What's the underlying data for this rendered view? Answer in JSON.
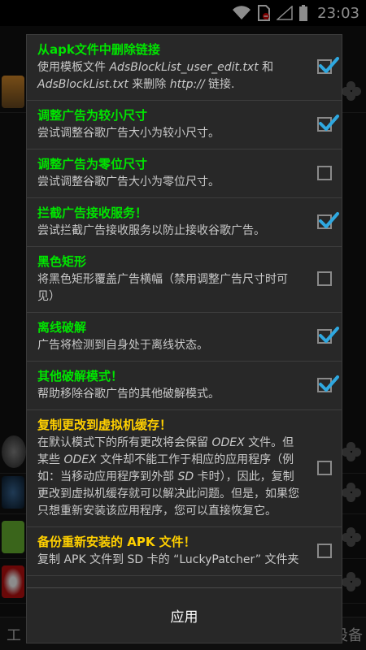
{
  "status_bar": {
    "time": "23:03"
  },
  "background": {
    "bottom_left": "工",
    "bottom_right": "载设备"
  },
  "dialog": {
    "items": [
      {
        "title": "从apk文件中删除链接",
        "title_color": "green",
        "desc": [
          "使用模板文件 ",
          {
            "i": "AdsBlockList_user_edit.txt"
          },
          " 和 ",
          {
            "i": "AdsBlockList.txt"
          },
          " 来删除 ",
          {
            "i": "http://"
          },
          " 链接."
        ],
        "checked": true
      },
      {
        "title": "调整广告为较小尺寸",
        "title_color": "green",
        "desc": [
          "尝试调整谷歌广告大小为较小尺寸。"
        ],
        "checked": true
      },
      {
        "title": "调整广告为零位尺寸",
        "title_color": "green",
        "desc": [
          "尝试调整谷歌广告大小为零位尺寸。"
        ],
        "checked": false
      },
      {
        "title": "拦截广告接收服务！",
        "title_color": "green",
        "desc": [
          "尝试拦截广告接收服务以防止接收谷歌广告。"
        ],
        "checked": true
      },
      {
        "title": "黑色矩形",
        "title_color": "green",
        "desc": [
          "将黑色矩形覆盖广告横幅（禁用调整广告尺寸时可见）"
        ],
        "checked": false
      },
      {
        "title": "离线破解",
        "title_color": "green",
        "desc": [
          "广告将检测到自身处于离线状态。"
        ],
        "checked": true
      },
      {
        "title": "其他破解模式！",
        "title_color": "green",
        "desc": [
          "帮助移除谷歌广告的其他破解模式。"
        ],
        "checked": true
      },
      {
        "title": "复制更改到虚拟机缓存！",
        "title_color": "yellow",
        "desc": [
          "在默认模式下的所有更改将会保留 ",
          {
            "i": "ODEX"
          },
          " 文件。但某些 ",
          {
            "i": "ODEX"
          },
          " 文件却不能工作于相应的应用程序（例如：当移动应用程序到外部 ",
          {
            "i": "SD"
          },
          " 卡时），因此，复制更改到虚拟机缓存就可以解决此问题。但是，如果您只想重新安装该应用程序，您可以直接恢复它。"
        ],
        "checked": false
      },
      {
        "title": "备份重新安装的 APK 文件！",
        "title_color": "yellow",
        "desc": [
          "复制 APK 文件到 SD 卡的 “LuckyPatcher” 文件夹"
        ],
        "checked": false
      }
    ],
    "apply_label": "应用"
  },
  "colors": {
    "green": "#00e400",
    "yellow": "#ffd000",
    "check": "#2fa8e0"
  }
}
